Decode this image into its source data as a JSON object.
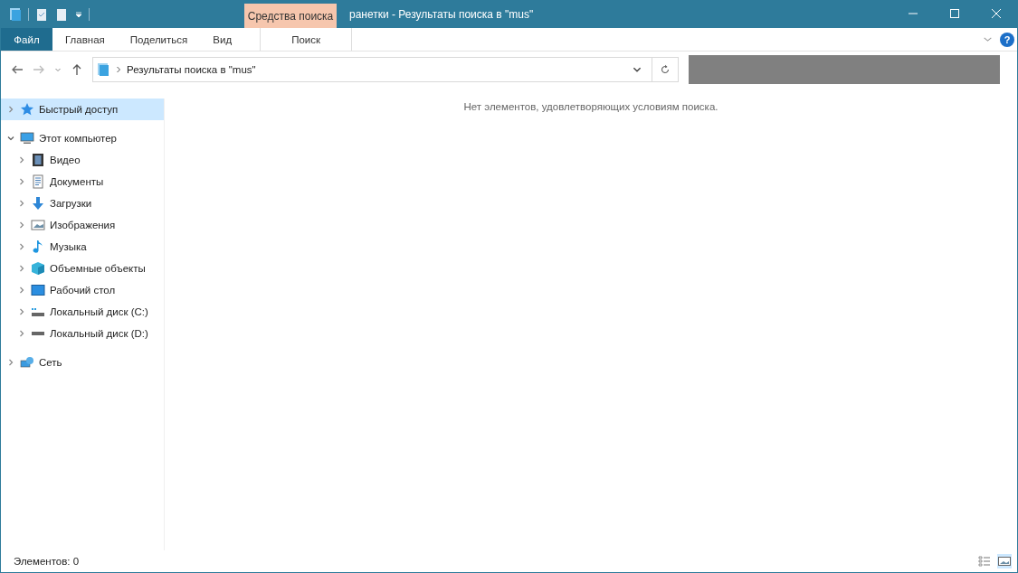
{
  "window": {
    "title": "ранетки - Результаты поиска в \"mus\""
  },
  "context_tab_group": {
    "label": "Средства поиска"
  },
  "ribbon_tabs": [
    {
      "label": "Файл",
      "kind": "file",
      "selected": false
    },
    {
      "label": "Главная",
      "kind": "tab",
      "selected": false
    },
    {
      "label": "Поделиться",
      "kind": "tab",
      "selected": false
    },
    {
      "label": "Вид",
      "kind": "tab",
      "selected": false
    },
    {
      "label": "Поиск",
      "kind": "context",
      "selected": false
    }
  ],
  "address_bar": {
    "path": "Результаты поиска в \"mus\""
  },
  "help_button": "?",
  "nav_tree": [
    {
      "label": "Быстрый доступ",
      "kind": "quick",
      "selected": true,
      "expanded": false
    },
    {
      "label": "Этот компьютер",
      "kind": "pc",
      "selected": false,
      "expanded": true,
      "children": [
        {
          "label": "Видео",
          "kind": "video",
          "selected": false,
          "expanded": false
        },
        {
          "label": "Документы",
          "kind": "docs",
          "selected": false,
          "expanded": false
        },
        {
          "label": "Загрузки",
          "kind": "downloads",
          "selected": false,
          "expanded": false
        },
        {
          "label": "Изображения",
          "kind": "pictures",
          "selected": false,
          "expanded": false
        },
        {
          "label": "Музыка",
          "kind": "music",
          "selected": false,
          "expanded": false
        },
        {
          "label": "Объемные объекты",
          "kind": "objects3d",
          "selected": false,
          "expanded": false
        },
        {
          "label": "Рабочий стол",
          "kind": "desktop",
          "selected": false,
          "expanded": false
        },
        {
          "label": "Локальный диск (C:)",
          "kind": "sysdrive",
          "selected": false,
          "expanded": false
        },
        {
          "label": "Локальный диск (D:)",
          "kind": "drive",
          "selected": false,
          "expanded": false
        }
      ]
    },
    {
      "label": "Сеть",
      "kind": "network",
      "selected": false,
      "expanded": false
    }
  ],
  "empty_message": "Нет элементов, удовлетворяющих условиям поиска.",
  "status_bar": {
    "item_count": "Элементов: 0"
  }
}
